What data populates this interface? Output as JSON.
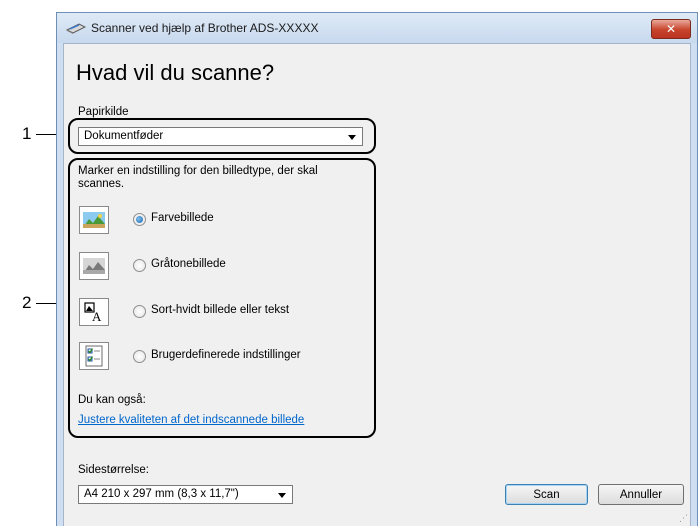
{
  "callouts": {
    "one": "1",
    "two": "2"
  },
  "window": {
    "title": "Scanner ved hjælp af Brother ADS-XXXXX",
    "close": "✕"
  },
  "main": {
    "heading": "Hvad vil du scanne?",
    "paper_source_label": "Papirkilde",
    "paper_source_value": "Dokumentføder",
    "instruction": "Marker en indstilling for den billedtype, der skal scannes.",
    "options": [
      {
        "label": "Farvebillede",
        "selected": true,
        "icon": "color-photo-icon"
      },
      {
        "label": "Gråtonebillede",
        "selected": false,
        "icon": "grayscale-photo-icon"
      },
      {
        "label": "Sort-hvidt billede eller tekst",
        "selected": false,
        "icon": "bw-text-icon"
      },
      {
        "label": "Brugerdefinerede indstillinger",
        "selected": false,
        "icon": "custom-settings-icon"
      }
    ],
    "also_label": "Du kan også:",
    "adjust_link": "Justere kvaliteten af det indscannede billede",
    "page_size_label": "Sidestørrelse:",
    "page_size_value": "A4 210 x 297 mm (8,3 x 11,7\")"
  },
  "buttons": {
    "scan": "Scan",
    "cancel": "Annuller"
  },
  "colors": {
    "accent_link": "#0066cc",
    "close_red": "#c8432b",
    "title_bar": "#cfdff1"
  }
}
